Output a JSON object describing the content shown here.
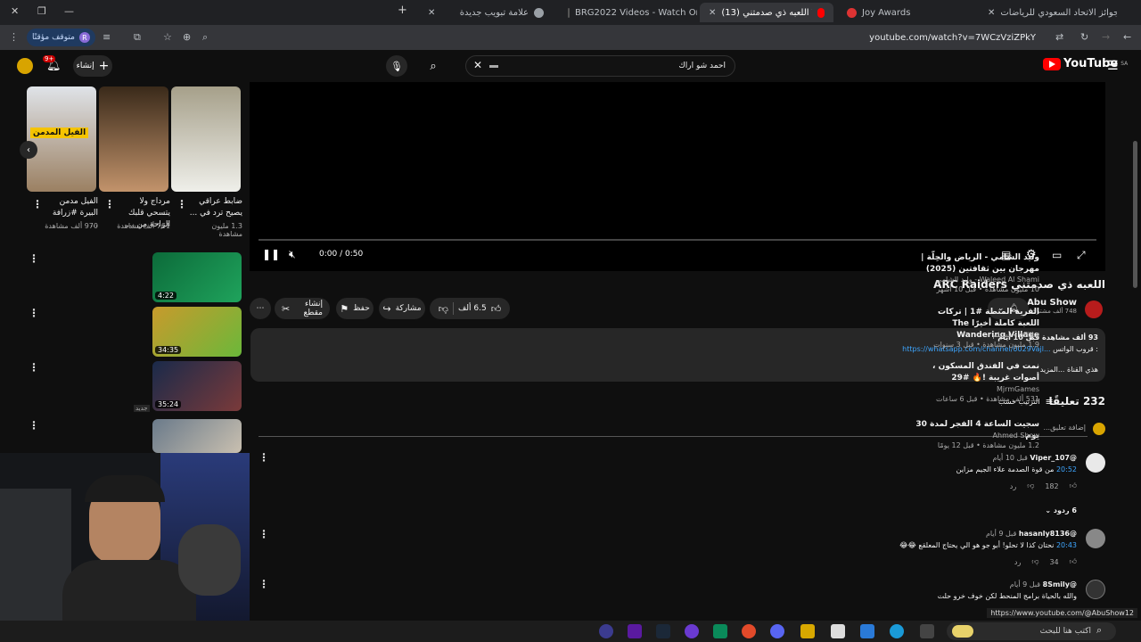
{
  "browser": {
    "tabs": [
      {
        "label": "جوائز الاتحاد السعودي للرياضات",
        "active": false
      },
      {
        "label": "Joy Awards",
        "active": false
      },
      {
        "label": "(13) اللعبه ذي صدمتني YouTube",
        "active": true
      },
      {
        "label": "BRG2022 Videos - Watch On-D",
        "active": false
      },
      {
        "label": "علامة تبويب جديدة",
        "active": false
      }
    ],
    "url": "youtube.com/watch?v=7WCzVziZPkY",
    "profile_pill": "متوقف مؤقتًا",
    "profile_initial": "R"
  },
  "header": {
    "logo_text": "YouTube",
    "region": "SA",
    "search_value": "احمد شو اراك",
    "create_label": "إنشاء",
    "notifications_count": "9+"
  },
  "player": {
    "time": "0:00 / 0:50"
  },
  "video": {
    "title": "اللعبه ذي صدمتني ARC Raiders",
    "channel": "Abu Show",
    "subscribers": "748 ألف مشترك",
    "likes": "6.5 ألف",
    "share_label": "مشاركة",
    "save_label": "حفظ",
    "clip_label": "إنشاء مقطع",
    "views_date": "93 ألف مشاهدة  قبل 10 أيام",
    "desc_prefix": "قروب الواتس :",
    "desc_link": "https://whatsapp.com/channel/0029Vajl...",
    "desc_more": "هذي القناة  ...المزيد"
  },
  "comments": {
    "count": "232 تعليقًا",
    "sort_label": "الترتيب حسب",
    "add_placeholder": "إضافة تعليق...",
    "items": [
      {
        "handle": "@Viper_107",
        "time": "قبل 10 أيام",
        "ts": "20:52",
        "text": "من قوة الصدمة علاء الجيم مزاين",
        "likes": "182",
        "reply": "رد",
        "replies": "6 ردود"
      },
      {
        "handle": "@hasanly8136",
        "time": "قبل 9 أيام",
        "ts": "20:43",
        "text": "نحتان كذا لا تحلو! أبو جو هو الي يحتاج المعلقع 😂😂",
        "likes": "34",
        "reply": "رد"
      },
      {
        "handle": "@8Smily",
        "time": "قبل 9 أيام",
        "text": "والله بالحياة برامج المنحط لكن خوف خرو حلت"
      }
    ]
  },
  "shorts": [
    {
      "caption": "الفيل مدمن البيرة #زرافة ...",
      "views": "970 ألف مشاهدة",
      "overlay": "الفيل المدمن"
    },
    {
      "caption": "مرداج ولا يتسحي قلبك الراحة من ...",
      "views": "761 ألف مشاهدة"
    },
    {
      "caption": "ضابط عراقي يصيح ترد في ...",
      "views": "1.3 مليون مشاهدة"
    }
  ],
  "related": [
    {
      "title": "وليد الشامي - الرياض والحِلّة | مهرجان بين ثقافتين (2025)",
      "channel": "Waleed Al Shami - وليد الشامي",
      "meta": "10 مليون مشاهدة • قبل 10 أشهر",
      "duration": "4:22"
    },
    {
      "title": "القرية المتطة #1 | تركات اللعبة كاملة أخيرًا The Wandering Village",
      "channel": "oPiiLz - مستلم",
      "meta": "1.9 مليون مشاهدة • قبل 3 سنوات",
      "duration": "34:35"
    },
    {
      "title": "نمت في الفندق المسكون ، أصوات غريبة !🔥 #29",
      "channel": "MjrmGames",
      "meta": "531 ألف مشاهدة • قبل 6 ساعات",
      "duration": "35:24",
      "badge": "جديد"
    },
    {
      "title": "سجيت الساعة 4 الفجر لمدة 30 يوم",
      "channel": "Ahmed Show",
      "meta": "1.2 مليون مشاهدة • قبل 12 يومًا",
      "duration": ""
    }
  ],
  "status_url": "https://www.youtube.com/@AbuShow12",
  "taskbar": {
    "search_placeholder": "اكتب هنا للبحث"
  }
}
